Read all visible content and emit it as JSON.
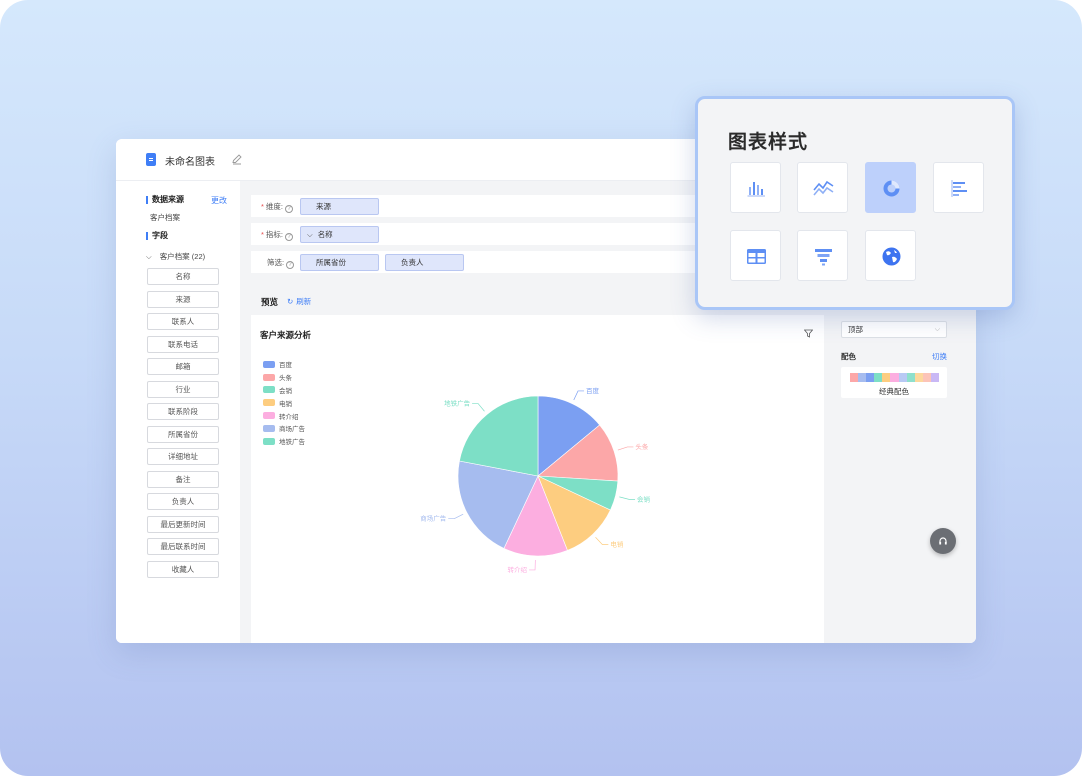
{
  "header": {
    "doc_title": "未命名图表"
  },
  "sidebar": {
    "data_source_label": "数据来源",
    "change_link": "更改",
    "data_source_value": "客户档案",
    "fields_label": "字段",
    "group_label": "客户档案 (22)",
    "fields": [
      "名称",
      "来源",
      "联系人",
      "联系电话",
      "邮箱",
      "行业",
      "联系阶段",
      "所属省份",
      "详细地址",
      "备注",
      "负责人",
      "最后更新时间",
      "最后联系时间",
      "收藏人"
    ]
  },
  "config": {
    "dimension_label": "维度:",
    "dimension_value": "来源",
    "metric_label": "指标:",
    "metric_value": "名称",
    "filter_label": "筛选:",
    "filter_values": [
      "所属省份",
      "负责人"
    ],
    "help_glyph": "?"
  },
  "preview": {
    "label": "预览",
    "refresh_label": "刷新",
    "chart_title": "客户来源分析"
  },
  "chart_data": {
    "type": "pie",
    "title": "客户来源分析",
    "legend_position": "top-left",
    "slices": [
      {
        "name": "百度",
        "value": 14,
        "color": "#7b9ff2"
      },
      {
        "name": "头条",
        "value": 12,
        "color": "#fca7a8"
      },
      {
        "name": "会销",
        "value": 6,
        "color": "#7ddfc6"
      },
      {
        "name": "电销",
        "value": 12,
        "color": "#fdcd80"
      },
      {
        "name": "转介绍",
        "value": 13,
        "color": "#fcaee0"
      },
      {
        "name": "商场广告",
        "value": 21,
        "color": "#a6bcef"
      },
      {
        "name": "地铁广告",
        "value": 22,
        "color": "#7ddfc6"
      }
    ]
  },
  "right_panel": {
    "legend_position_value": "顶部",
    "color_label": "配色",
    "switch_link": "切换",
    "palette_name": "经典配色",
    "palette_colors": [
      "#fca7a8",
      "#a6bcef",
      "#7b9ff2",
      "#7ddfc6",
      "#fdcd80",
      "#fcaee0",
      "#b8c9f4",
      "#8ee0cc",
      "#fdd89d",
      "#fcc4b8",
      "#c9b8f5"
    ]
  },
  "popup": {
    "title": "图表样式",
    "active_icon": "pie-chart-icon",
    "icons": [
      "bar-chart-icon",
      "line-chart-icon",
      "pie-chart-icon",
      "horizontal-bar-icon",
      "table-icon",
      "funnel-icon",
      "globe-icon"
    ]
  }
}
